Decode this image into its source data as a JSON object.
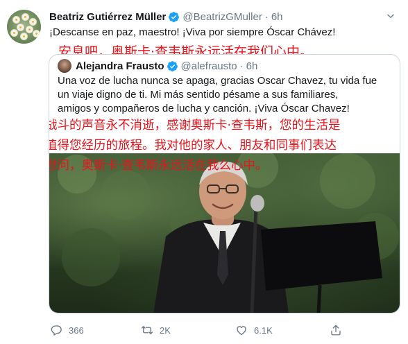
{
  "tweet": {
    "author_name": "Beatriz Gutiérrez Müller",
    "author_handle": "@BeatrizGMuller",
    "separator": "·",
    "time": "6h",
    "text": "¡Descanse en paz, maestro! ¡Viva por siempre Óscar Chávez!",
    "translation": "安息吧，奥斯卡·查韦斯永远活在我们心中。"
  },
  "quote": {
    "author_name": "Alejandra Frausto",
    "author_handle": "@alefrausto",
    "separator": "·",
    "time": "6h",
    "text_lines": [
      "Una voz de lucha nunca se apaga, gracias Oscar Chavez, tu vida fue",
      "un viaje digno de ti. Mi más sentido pésame a sus familiares,",
      "amigos y compañeros de lucha y canción. ¡Viva Óscar Chavez!"
    ],
    "translation_lines": [
      "战斗的声音永不消逝，感谢奥斯卡·查韦斯，您的生活是",
      "值得您经历的旅程。我对他的家人、朋友和同事们表达",
      "慰问，奥斯卡·查韦斯永远活在我么心中。"
    ]
  },
  "actions": {
    "replies": "366",
    "retweets": "2K",
    "likes": "6.1K"
  },
  "colors": {
    "accent": "#1da1f2",
    "muted": "#657786",
    "annotation": "#e8141b"
  },
  "icons": [
    "verified-badge-icon",
    "chevron-down-icon",
    "reply-icon",
    "retweet-icon",
    "like-icon",
    "share-icon"
  ]
}
